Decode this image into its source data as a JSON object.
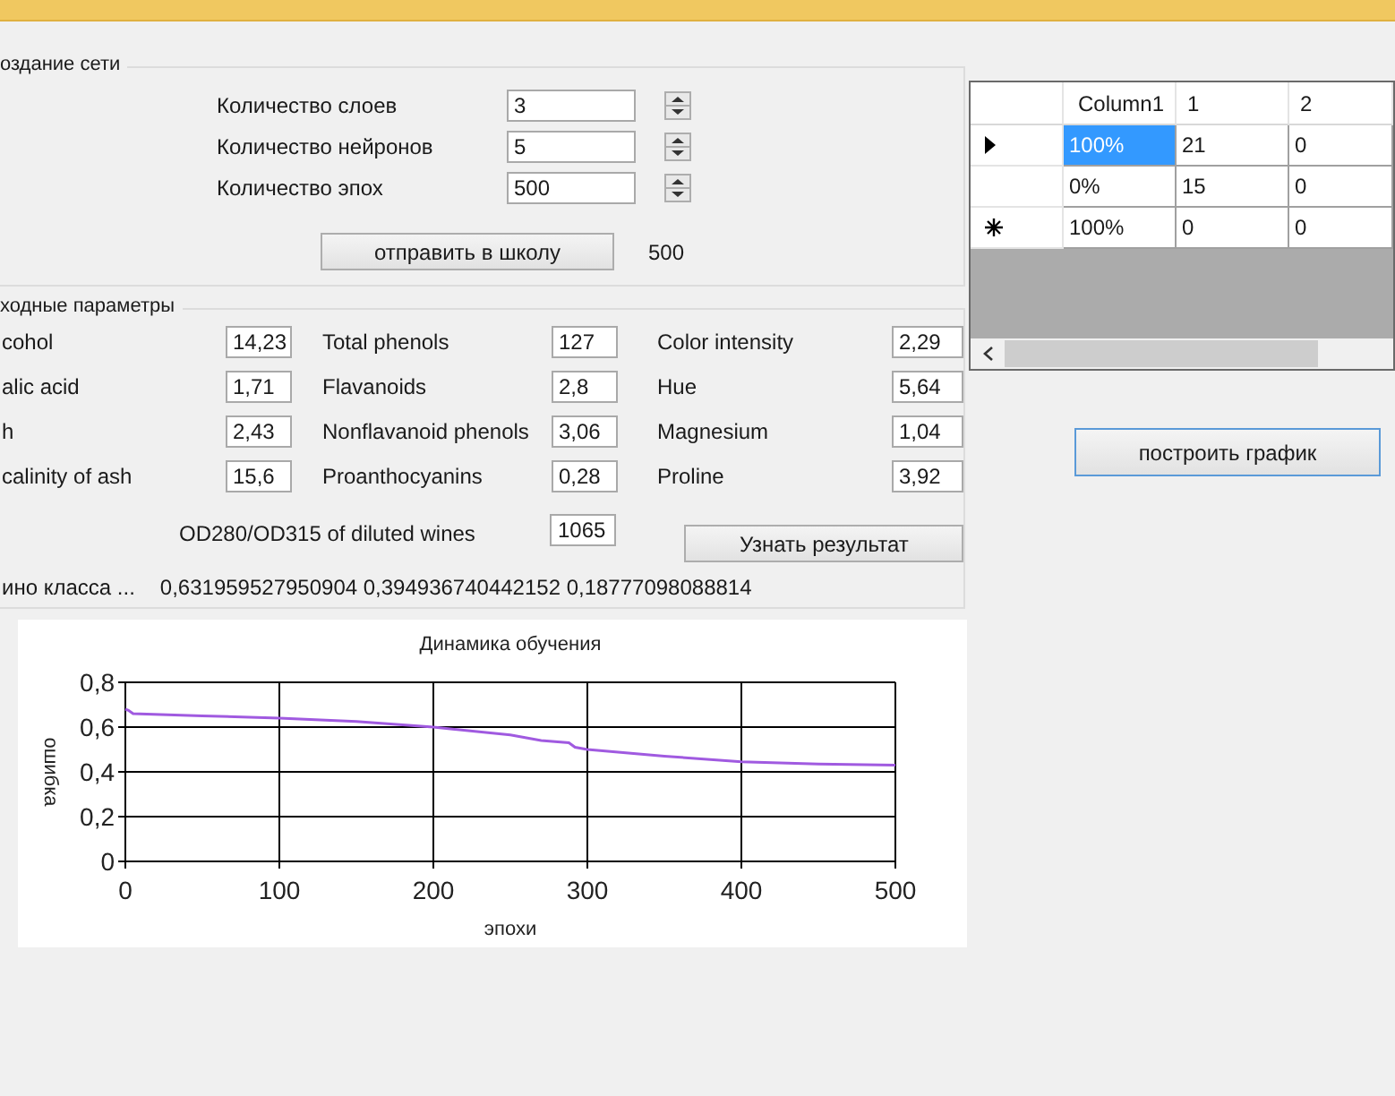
{
  "network_group": {
    "title": "оздание сети",
    "fields": [
      {
        "label": "Количество слоев",
        "value": "3"
      },
      {
        "label": "Количество нейронов",
        "value": "5"
      },
      {
        "label": "Количество эпох",
        "value": "500"
      }
    ],
    "submit_button": "отправить в школу",
    "epochs_output": "500"
  },
  "params_group": {
    "title": "ходные параметры",
    "fields": [
      {
        "label": "cohol",
        "value": "14,23"
      },
      {
        "label": "Total phenols",
        "value": "127"
      },
      {
        "label": "Color intensity",
        "value": "2,29"
      },
      {
        "label": "alic acid",
        "value": "1,71"
      },
      {
        "label": "Flavanoids",
        "value": "2,8"
      },
      {
        "label": "Hue",
        "value": "5,64"
      },
      {
        "label": "h",
        "value": "2,43"
      },
      {
        "label": "Nonflavanoid phenols",
        "value": "3,06"
      },
      {
        "label": "Magnesium",
        "value": "1,04"
      },
      {
        "label": "calinity of ash",
        "value": "15,6"
      },
      {
        "label": "Proanthocyanins",
        "value": "0,28"
      },
      {
        "label": "Proline",
        "value": "3,92"
      }
    ],
    "extra_field": {
      "label": "OD280/OD315 of diluted wines",
      "value": "1065"
    },
    "result_button": "Узнать результат",
    "result_label": "ино класса ...",
    "result_values": "0,631959527950904 0,394936740442152 0,18777098088814"
  },
  "chart": {
    "chart_data": {
      "type": "line",
      "title": "Динамика обучения",
      "xlabel": "эпохи",
      "ylabel": "ошибка",
      "x": [
        0,
        2,
        5,
        50,
        100,
        150,
        200,
        250,
        270,
        288,
        292,
        300,
        350,
        400,
        450,
        500
      ],
      "series": [
        {
          "color": "#a05ae0",
          "values": [
            0.68,
            0.675,
            0.66,
            0.65,
            0.64,
            0.625,
            0.6,
            0.565,
            0.54,
            0.53,
            0.51,
            0.5,
            0.47,
            0.445,
            0.435,
            0.43
          ]
        }
      ],
      "xlim": [
        0,
        500
      ],
      "ylim": [
        0,
        0.8
      ],
      "xticks": [
        0,
        100,
        200,
        300,
        400,
        500
      ],
      "yticks": [
        0,
        {
          "value": 0.2,
          "label": "0,2"
        },
        {
          "value": 0.4,
          "label": "0,4"
        },
        {
          "value": 0.6,
          "label": "0,6"
        },
        {
          "value": 0.8,
          "label": "0,8"
        }
      ],
      "grid": true
    }
  },
  "grid": {
    "columns": [
      "Column1",
      "1",
      "2"
    ],
    "rows": [
      {
        "kind": "current",
        "cells": [
          {
            "text": "100%",
            "selected": true
          },
          {
            "text": "21",
            "selected": false
          },
          {
            "text": "0",
            "selected": false
          }
        ]
      },
      {
        "kind": "plain",
        "cells": [
          {
            "text": "0%",
            "selected": false
          },
          {
            "text": "15",
            "selected": false
          },
          {
            "text": "0",
            "selected": false
          }
        ]
      },
      {
        "kind": "new",
        "cells": [
          {
            "text": "100%",
            "selected": false
          },
          {
            "text": "0",
            "selected": false
          },
          {
            "text": "0",
            "selected": false
          }
        ]
      }
    ]
  },
  "plot_button": "построить график"
}
